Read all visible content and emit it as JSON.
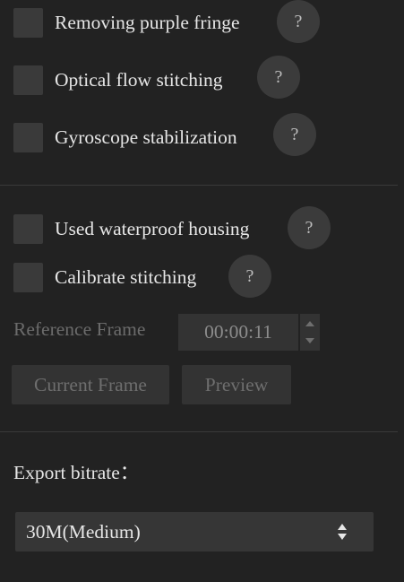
{
  "options": [
    {
      "label": "Removing purple fringe",
      "checked": false,
      "help": "?"
    },
    {
      "label": "Optical flow stitching",
      "checked": false,
      "help": "?"
    },
    {
      "label": "Gyroscope stabilization",
      "checked": false,
      "help": "?"
    },
    {
      "label": "Used waterproof housing",
      "checked": false,
      "help": "?"
    },
    {
      "label": "Calibrate stitching",
      "checked": false,
      "help": "?"
    }
  ],
  "reference_frame": {
    "label": "Reference Frame",
    "time": "00:00:11",
    "current_frame_button": "Current Frame",
    "preview_button": "Preview"
  },
  "export": {
    "label": "Export bitrate：",
    "selected": "30M(Medium)"
  }
}
